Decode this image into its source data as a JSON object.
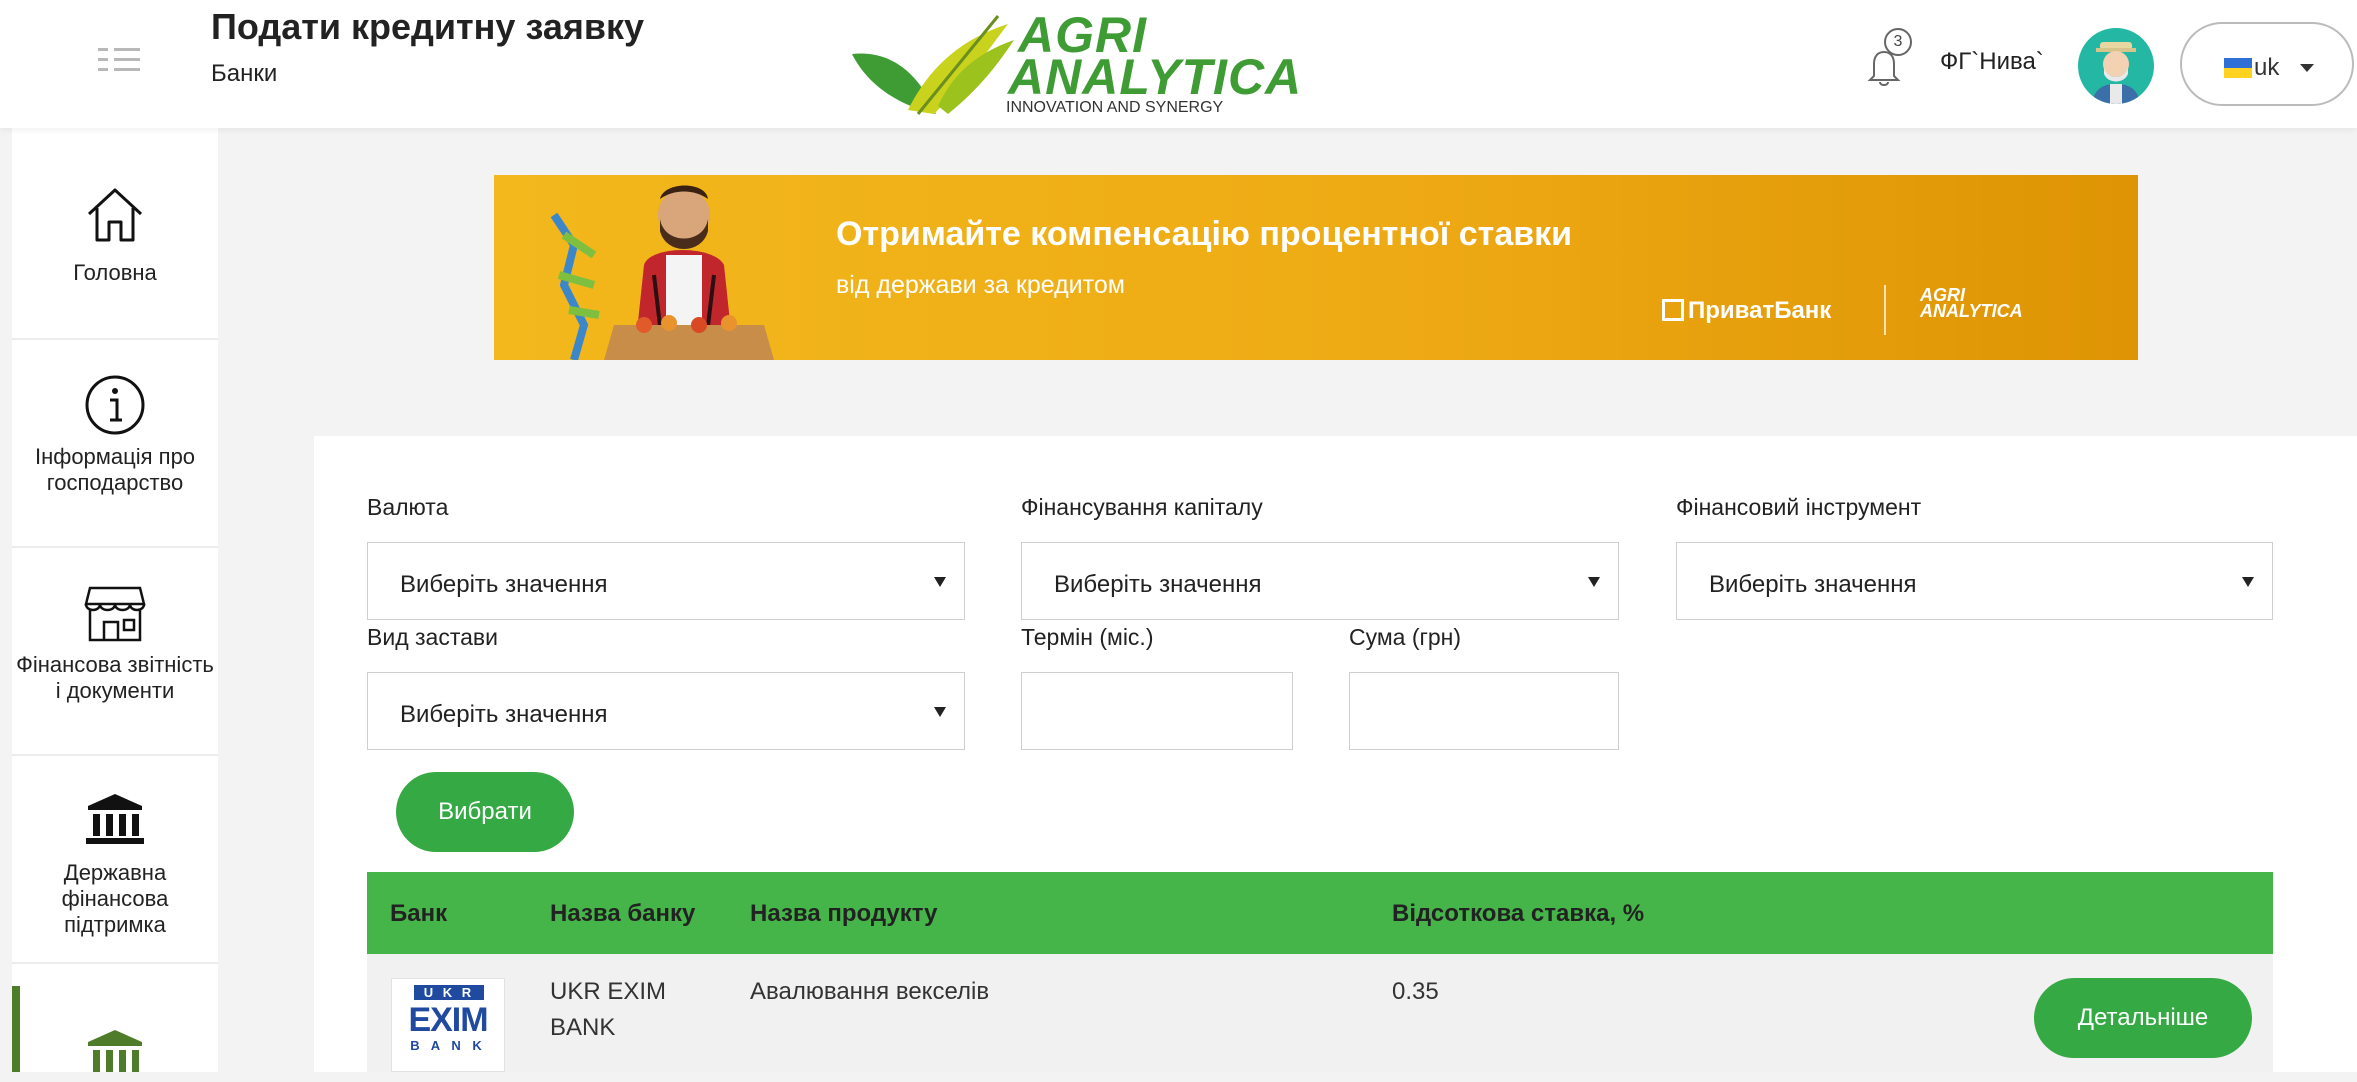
{
  "header": {
    "title": "Подати кредитну заявку",
    "breadcrumb": "Банки",
    "logo": {
      "line1": "AGRI",
      "line2": "ANALYTICA",
      "tagline": "INNOVATION AND SYNERGY"
    },
    "notifications_count": "3",
    "farm_name": "ФГ`Нива`",
    "language": "uk"
  },
  "sidebar": {
    "items": [
      {
        "label": "Головна",
        "icon": "home-icon"
      },
      {
        "label": "Інформація про господарство",
        "icon": "info-icon"
      },
      {
        "label": "Фінансова звітність і документи",
        "icon": "store-icon"
      },
      {
        "label": "Державна фінансова підтримка",
        "icon": "bank-icon"
      },
      {
        "label": "",
        "icon": "bank-icon"
      }
    ]
  },
  "banner": {
    "title": "Отримайте компенсацію процентної ставки",
    "subtitle": "від держави за кредитом",
    "bank": "ПриватБанк",
    "partner_logo_line1": "AGRI",
    "partner_logo_line2": "ANALYTICA"
  },
  "filters": {
    "currency_label": "Валюта",
    "currency_value": "Виберіть значення",
    "capital_label": "Фінансування капіталу",
    "capital_value": "Виберіть значення",
    "instrument_label": "Фінансовий інструмент",
    "instrument_value": "Виберіть значення",
    "collateral_label": "Вид застави",
    "collateral_value": "Виберіть значення",
    "term_label": "Термін (міс.)",
    "term_value": "",
    "amount_label": "Сума (грн)",
    "amount_value": "",
    "submit_label": "Вибрати"
  },
  "table": {
    "columns": [
      "Банк",
      "Назва банку",
      "Назва продукту",
      "Відсоткова ставка, %"
    ],
    "rows": [
      {
        "bank_logo": {
          "top": "U K R",
          "middle": "EXIM",
          "bottom": "B A N K"
        },
        "bank_name_line1": "UKR EXIM",
        "bank_name_line2": "BANK",
        "product": "Авалювання векселів",
        "rate": "0.35",
        "details_label": "Детальніше"
      }
    ]
  },
  "colors": {
    "brand_green": "#3f9c35",
    "table_header": "#46b549",
    "button_green": "#35a944",
    "banner_yellow": "#f2b81c"
  }
}
